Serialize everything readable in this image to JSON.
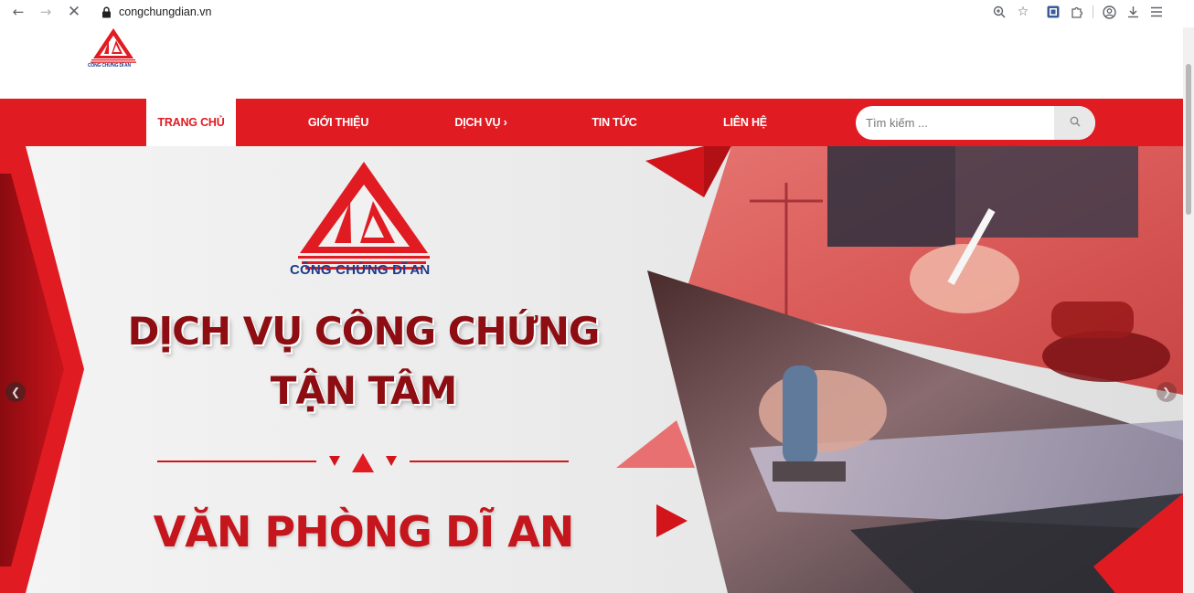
{
  "browser": {
    "url": "congchungdian.vn",
    "icons": [
      "back-arrow-icon",
      "forward-arrow-icon",
      "stop-loading-icon",
      "lock-icon",
      "zoom-icon",
      "star-icon",
      "extension-icon",
      "puzzle-icon",
      "profile-icon",
      "download-icon",
      "menu-icon"
    ]
  },
  "site": {
    "logo_text": "CÔNG CHỨNG DĨ AN",
    "brand_color": "#e11b22",
    "dark_red": "#8d0d12",
    "navy": "#1d3b8c"
  },
  "nav": {
    "items": [
      {
        "label": "TRANG CHỦ",
        "active": true
      },
      {
        "label": "GIỚI THIỆU",
        "active": false
      },
      {
        "label": "DỊCH VỤ ›",
        "active": false
      },
      {
        "label": "TIN TỨC",
        "active": false
      },
      {
        "label": "LIÊN HỆ",
        "active": false
      }
    ],
    "search_placeholder": "Tìm kiếm ..."
  },
  "hero": {
    "logo_label": "CÔNG CHỨNG DĨ AN",
    "title_line1": "DỊCH VỤ CÔNG CHỨNG",
    "title_line2": "TẬN TÂM",
    "subtitle": "VĂN PHÒNG DĨ AN"
  }
}
